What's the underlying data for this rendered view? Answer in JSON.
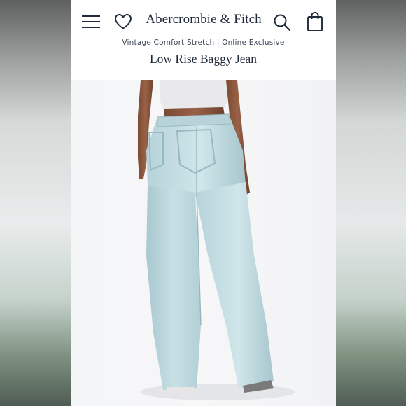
{
  "header": {
    "brand": "Abercrombie & Fitch",
    "subtitle": "Vintage Comfort Stretch | Online Exclusive",
    "product_name": "Low Rise Baggy Jean",
    "icons": [
      "menu-icon",
      "heart-icon",
      "search-icon",
      "bag-icon"
    ]
  },
  "product_image": {
    "description_icon": "product-photo"
  },
  "colors": {
    "text": "#1f2a3a",
    "denim": "#bcd8de",
    "background": "#ffffff"
  }
}
